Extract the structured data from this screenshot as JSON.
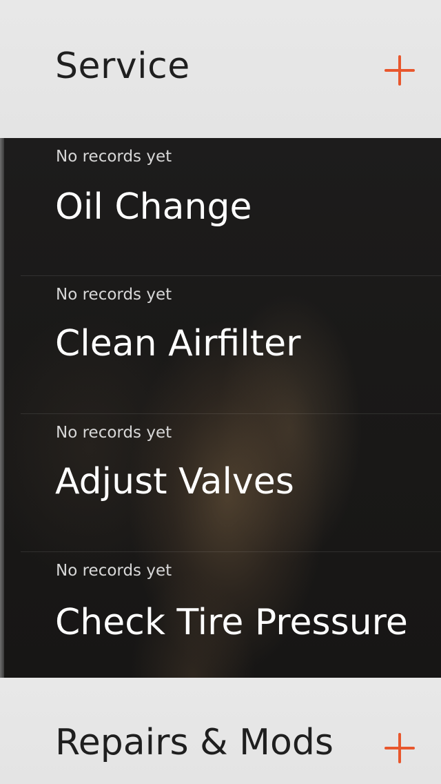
{
  "sections": {
    "service": {
      "title": "Service",
      "add_icon": "plus-icon",
      "accent_color": "#e8572d"
    },
    "repairs": {
      "title": "Repairs & Mods",
      "add_icon": "plus-icon",
      "accent_color": "#e8572d"
    }
  },
  "service_items": [
    {
      "status": "No records yet",
      "name": "Oil Change"
    },
    {
      "status": "No records yet",
      "name": "Clean Airfilter"
    },
    {
      "status": "No records yet",
      "name": "Adjust Valves"
    },
    {
      "status": "No records yet",
      "name": "Check Tire Pressure"
    }
  ]
}
